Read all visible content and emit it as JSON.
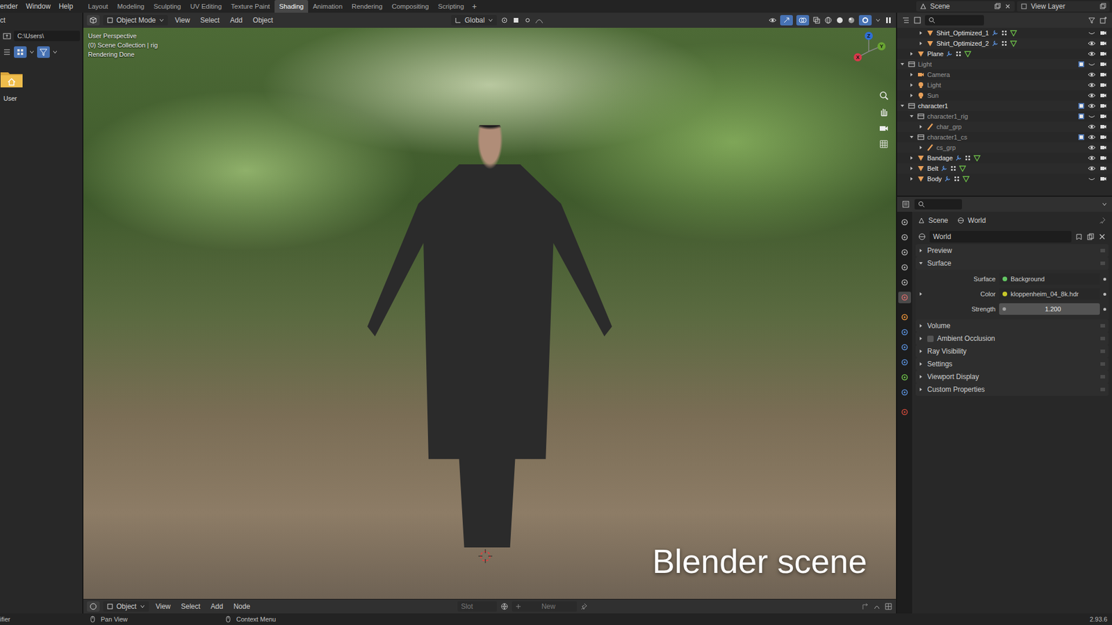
{
  "menu": [
    "ender",
    "Window",
    "Help"
  ],
  "workspaces": [
    {
      "label": "Layout",
      "selected": false
    },
    {
      "label": "Modeling",
      "selected": false
    },
    {
      "label": "Sculpting",
      "selected": false
    },
    {
      "label": "UV Editing",
      "selected": false
    },
    {
      "label": "Texture Paint",
      "selected": false
    },
    {
      "label": "Shading",
      "selected": true
    },
    {
      "label": "Animation",
      "selected": false
    },
    {
      "label": "Rendering",
      "selected": false
    },
    {
      "label": "Compositing",
      "selected": false
    },
    {
      "label": "Scripting",
      "selected": false
    }
  ],
  "add_workspace": "+",
  "scene": "Scene",
  "view_layer": "View Layer",
  "file_browser": {
    "title": "ct",
    "path": "C:\\Users\\",
    "items": [
      {
        "label": "User",
        "selected": false
      }
    ]
  },
  "viewport": {
    "mode": "Object Mode",
    "menus": [
      "View",
      "Select",
      "Add",
      "Object"
    ],
    "orientation": "Global",
    "overlay_text": [
      "User Perspective",
      "(0) Scene Collection | rig",
      "Rendering Done"
    ],
    "gizmo": [
      {
        "axis": "Z",
        "color": "#2f6fd6"
      },
      {
        "axis": "Y",
        "color": "#6aa532"
      },
      {
        "axis": "X",
        "color": "#d8394b"
      }
    ],
    "caption": "Blender scene"
  },
  "node_editor": {
    "type": "Object",
    "menus": [
      "View",
      "Select",
      "Add",
      "Node"
    ],
    "slot": "Slot",
    "new_button": "New"
  },
  "outliner": [
    {
      "name": "Shirt_Optimized_1",
      "depth": 2,
      "kind": "mesh",
      "expanded": false,
      "checked": false,
      "visible": false,
      "dimmed": false
    },
    {
      "name": "Shirt_Optimized_2",
      "depth": 2,
      "kind": "mesh",
      "expanded": false,
      "checked": false,
      "visible": true,
      "dimmed": false
    },
    {
      "name": "Plane",
      "depth": 1,
      "kind": "mesh",
      "expanded": false,
      "checked": false,
      "visible": true,
      "dimmed": false
    },
    {
      "name": "Light",
      "depth": 0,
      "kind": "collection",
      "expanded": true,
      "checked": true,
      "visible": false,
      "dimmed": true
    },
    {
      "name": "Camera",
      "depth": 1,
      "kind": "camera",
      "expanded": false,
      "checked": false,
      "visible": true,
      "dimmed": true
    },
    {
      "name": "Light",
      "depth": 1,
      "kind": "light",
      "expanded": false,
      "checked": false,
      "visible": true,
      "dimmed": true
    },
    {
      "name": "Sun",
      "depth": 1,
      "kind": "light",
      "expanded": false,
      "checked": false,
      "visible": true,
      "dimmed": true
    },
    {
      "name": "character1",
      "depth": 0,
      "kind": "collection",
      "expanded": true,
      "checked": true,
      "visible": true,
      "dimmed": false
    },
    {
      "name": "character1_rig",
      "depth": 1,
      "kind": "collection",
      "expanded": true,
      "checked": true,
      "visible": false,
      "dimmed": true
    },
    {
      "name": "char_grp",
      "depth": 2,
      "kind": "armature",
      "expanded": false,
      "checked": false,
      "visible": true,
      "dimmed": true
    },
    {
      "name": "character1_cs",
      "depth": 1,
      "kind": "collection",
      "expanded": true,
      "checked": true,
      "visible": true,
      "dimmed": true
    },
    {
      "name": "cs_grp",
      "depth": 2,
      "kind": "armature",
      "expanded": false,
      "checked": false,
      "visible": true,
      "dimmed": true
    },
    {
      "name": "Bandage",
      "depth": 1,
      "kind": "mesh",
      "expanded": false,
      "checked": false,
      "visible": true,
      "dimmed": false
    },
    {
      "name": "Belt",
      "depth": 1,
      "kind": "mesh",
      "expanded": false,
      "checked": false,
      "visible": true,
      "dimmed": false
    },
    {
      "name": "Body",
      "depth": 1,
      "kind": "mesh",
      "expanded": false,
      "checked": false,
      "visible": false,
      "dimmed": false
    }
  ],
  "properties": {
    "tabs": [
      {
        "color": "#b0b0b0",
        "selected": false
      },
      {
        "color": "#b0b0b0",
        "selected": false
      },
      {
        "color": "#b0b0b0",
        "selected": false
      },
      {
        "color": "#b0b0b0",
        "selected": false
      },
      {
        "color": "#b0b0b0",
        "selected": false
      },
      {
        "color": "#d06a6a",
        "selected": true
      },
      {
        "color": "#e8923a",
        "selected": false
      },
      {
        "color": "#5a8fd8",
        "selected": false
      },
      {
        "color": "#5a8fd8",
        "selected": false
      },
      {
        "color": "#5a8fd8",
        "selected": false
      },
      {
        "color": "#6fc24a",
        "selected": false
      },
      {
        "color": "#5a8fd8",
        "selected": false
      },
      {
        "color": "#c8483a",
        "selected": false
      }
    ],
    "breadcrumb": [
      "Scene",
      "World"
    ],
    "datablock": "World",
    "panels": [
      {
        "label": "Preview",
        "kind": "panel",
        "expanded": false,
        "checked": false,
        "fields": []
      },
      {
        "label": "Surface",
        "kind": "panel",
        "expanded": true,
        "checked": false,
        "fields": [
          {
            "label": "Surface",
            "value": "Background",
            "kind": "link",
            "color": "#63c763",
            "expandable": false
          },
          {
            "label": "Color",
            "value": "kloppenheim_04_8k.hdr",
            "kind": "link",
            "color": "#c7c729",
            "expandable": true
          },
          {
            "label": "Strength",
            "value": "1.200",
            "kind": "number",
            "color": "#a1a1a1",
            "expandable": false
          }
        ]
      },
      {
        "label": "Volume",
        "kind": "panel",
        "expanded": false,
        "checked": false,
        "fields": []
      },
      {
        "label": "Ambient Occlusion",
        "kind": "checkbox",
        "expanded": false,
        "checked": false,
        "fields": []
      },
      {
        "label": "Ray Visibility",
        "kind": "panel",
        "expanded": false,
        "checked": false,
        "fields": []
      },
      {
        "label": "Settings",
        "kind": "panel",
        "expanded": false,
        "checked": false,
        "fields": []
      },
      {
        "label": "Viewport Display",
        "kind": "panel",
        "expanded": false,
        "checked": false,
        "fields": []
      },
      {
        "label": "Custom Properties",
        "kind": "panel",
        "expanded": false,
        "checked": false,
        "fields": []
      }
    ]
  },
  "status_bar": {
    "left": "ifier",
    "hints": [
      "Pan View",
      "Context Menu"
    ],
    "version": "2.93.6"
  }
}
